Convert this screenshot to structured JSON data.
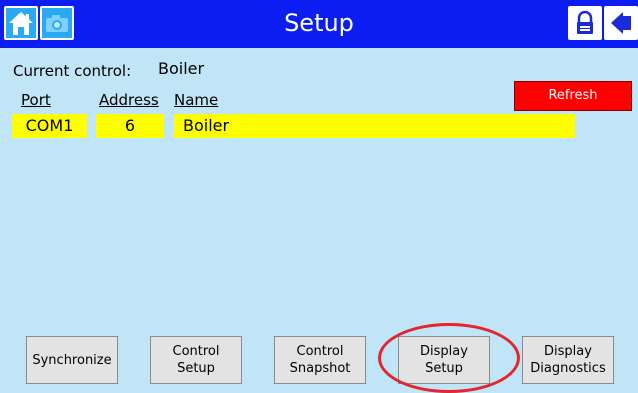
{
  "header": {
    "title": "Setup",
    "left_icons": [
      "home-icon",
      "camera-icon"
    ],
    "right_icons": [
      "lock-icon",
      "back-icon"
    ]
  },
  "current_control": {
    "label": "Current control:",
    "value": "Boiler"
  },
  "refresh_label": "Refresh",
  "table": {
    "headers": {
      "port": "Port",
      "address": "Address",
      "name": "Name"
    },
    "rows": [
      {
        "port": "COM1",
        "address": "6",
        "name": "Boiler"
      }
    ]
  },
  "bottom_buttons": [
    {
      "label": "Synchronize"
    },
    {
      "label": "Control\nSetup"
    },
    {
      "label": "Control\nSnapshot"
    },
    {
      "label": "Display\nSetup"
    },
    {
      "label": "Display\nDiagnostics"
    }
  ],
  "colors": {
    "header_bg": "#0b1df0",
    "background": "#bfe5f7",
    "row_highlight": "#ffff00",
    "refresh_bg": "#ff0000",
    "annotation_circle": "#e4252b"
  }
}
